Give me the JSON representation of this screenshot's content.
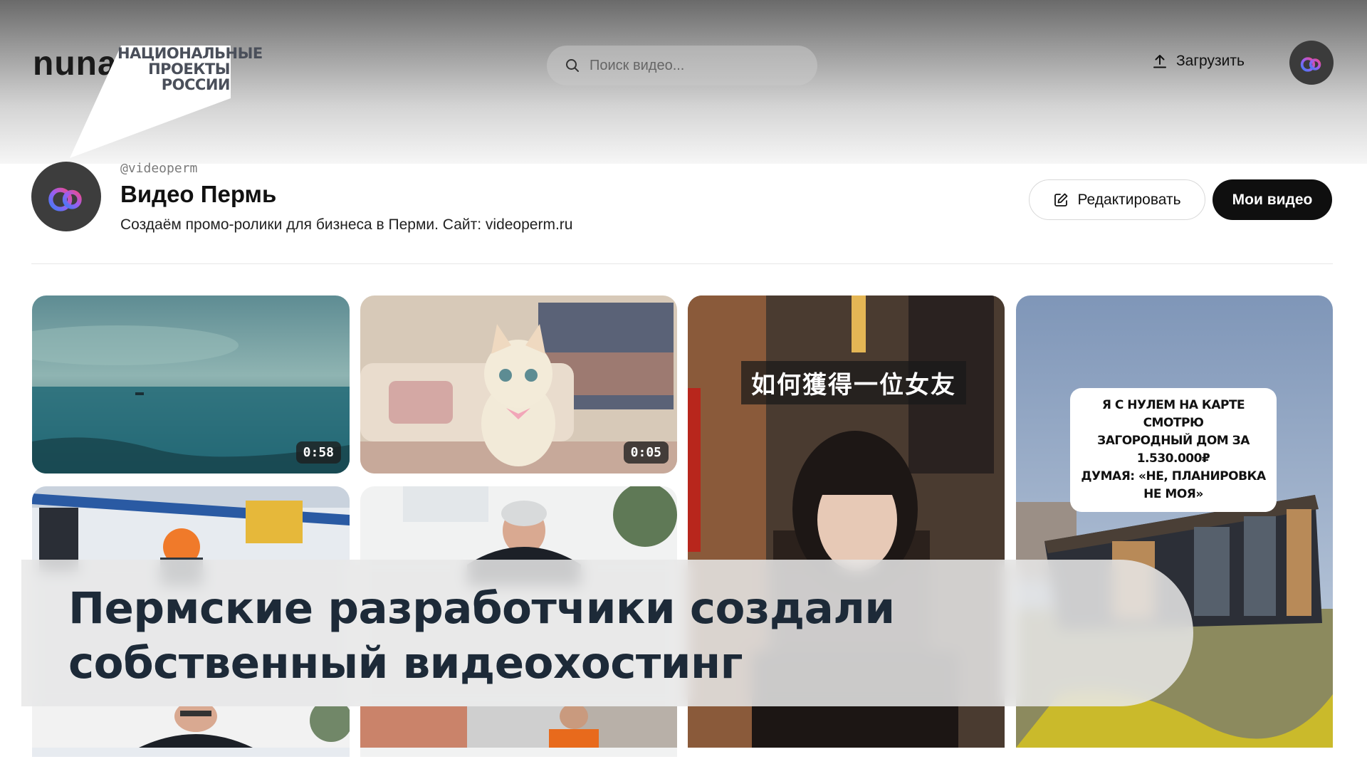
{
  "header": {
    "logo_text": "nuna",
    "badge_lines": [
      "НАЦИОНАЛЬНЫЕ",
      "ПРОЕКТЫ",
      "РОССИИ"
    ],
    "search_placeholder": "Поиск видео...",
    "upload_label": "Загрузить"
  },
  "channel": {
    "handle": "@videoperm",
    "name": "Видео Пермь",
    "description": "Создаём промо-ролики для бизнеса в Перми. Сайт: videoperm.ru",
    "edit_label": "Редактировать",
    "my_videos_label": "Мои видео"
  },
  "videos": [
    {
      "scene": "sea-boat",
      "duration": "0:58"
    },
    {
      "scene": "kitten-sofa",
      "duration": "0:05"
    },
    {
      "scene": "girl-street",
      "caption": "如何獲得一位女友"
    },
    {
      "scene": "modular-house",
      "caption_lines": [
        "Я С НУЛЕМ НА КАРТЕ СМОТРЮ",
        "ЗАГОРОДНЫЙ ДОМ ЗА 1.530.000₽",
        "ДУМАЯ: «НЕ, ПЛАНИРОВКА НЕ МОЯ»"
      ]
    },
    {
      "scene": "factory-worker"
    },
    {
      "scene": "man-office"
    },
    {
      "scene": "man-glasses"
    },
    {
      "scene": "worker-warehouse"
    }
  ],
  "banner": {
    "headline_lines": [
      "Пермские разработчики создали",
      "собственный видеохостинг"
    ]
  },
  "colors": {
    "accent_orange": "#e0541c",
    "button_dark": "#0f0f0f",
    "banner_text": "#1d2a38"
  }
}
